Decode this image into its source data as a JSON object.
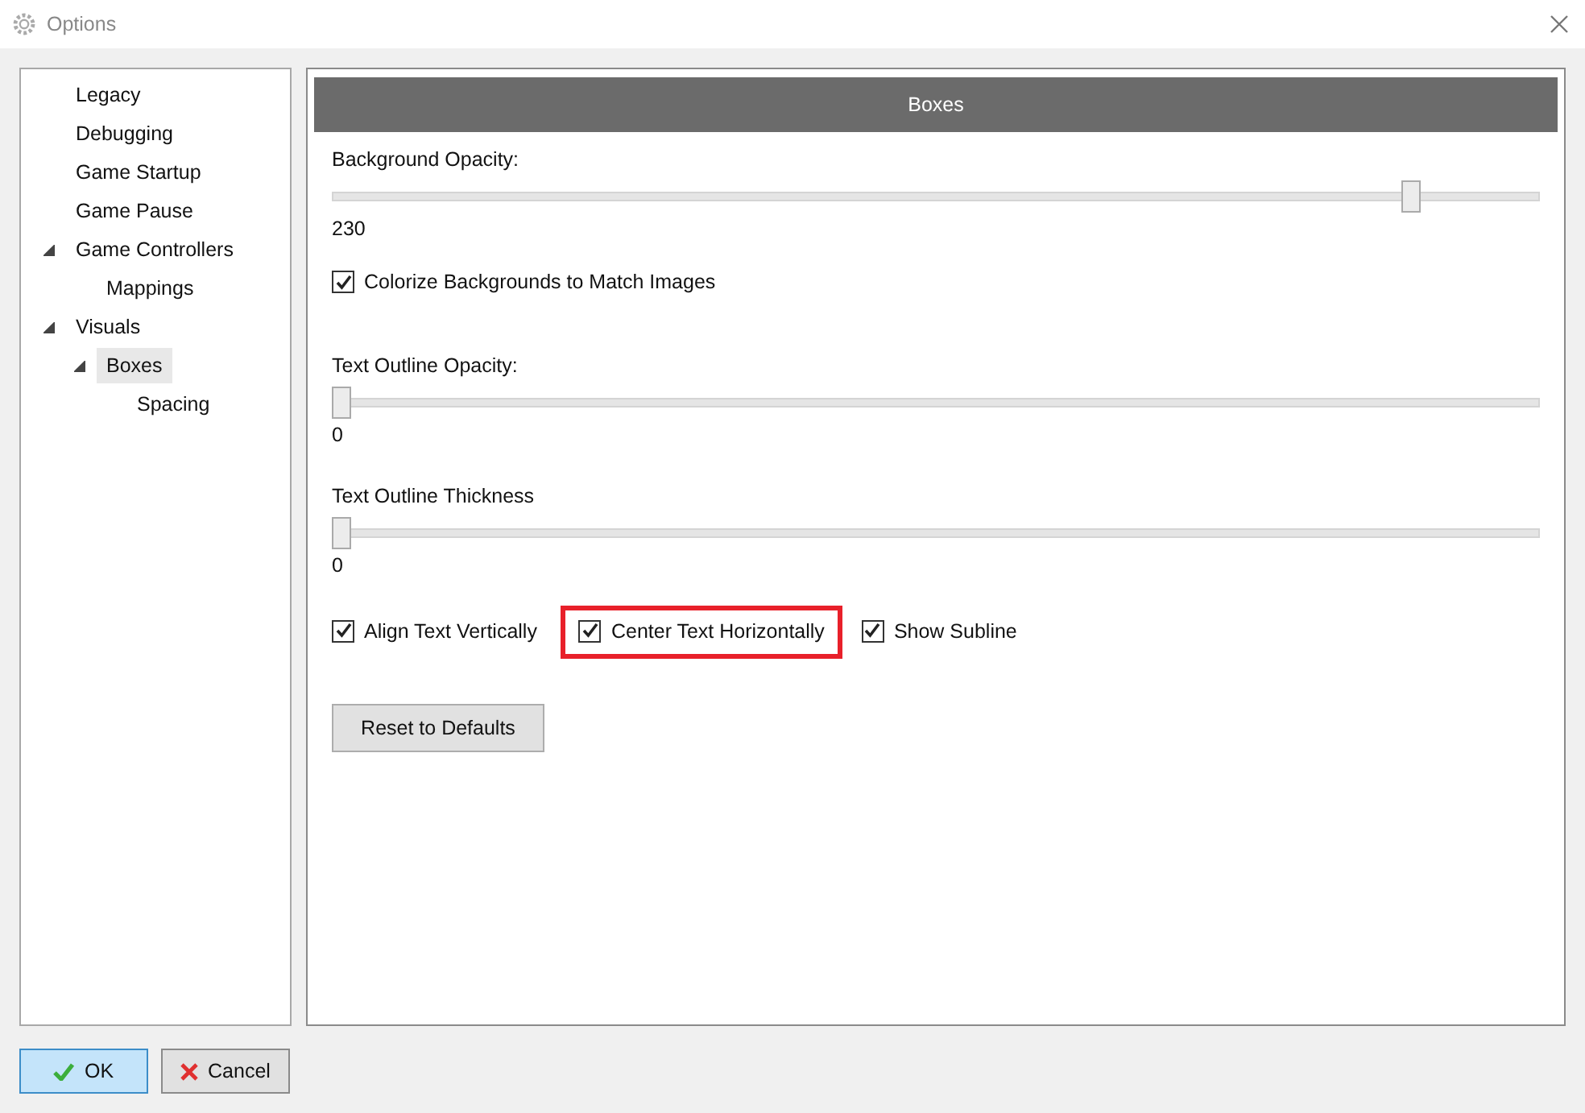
{
  "window": {
    "title": "Options"
  },
  "tree": [
    {
      "label": "Legacy",
      "selected": false
    },
    {
      "label": "Debugging",
      "selected": false
    },
    {
      "label": "Game Startup",
      "selected": false
    },
    {
      "label": "Game Pause",
      "selected": false
    },
    {
      "label": "Game Controllers",
      "selected": false,
      "expanded": true,
      "children": [
        {
          "label": "Mappings",
          "selected": false
        }
      ]
    },
    {
      "label": "Visuals",
      "selected": false,
      "expanded": true,
      "children": [
        {
          "label": "Boxes",
          "selected": true,
          "expanded": true,
          "children": [
            {
              "label": "Spacing",
              "selected": false
            }
          ]
        }
      ]
    }
  ],
  "panel": {
    "title": "Boxes",
    "sections": [
      {
        "kind": "slider",
        "label": "Background Opacity:",
        "level": 0.9,
        "reading": "230"
      },
      {
        "kind": "checkbox",
        "label": "Colorize Backgrounds to Match Images",
        "checked": true
      },
      {
        "kind": "slider",
        "label": "Text Outline Opacity:",
        "level": 0,
        "reading": "0"
      },
      {
        "kind": "slider",
        "label": "Text Outline Thickness",
        "level": 0,
        "reading": "0"
      }
    ],
    "options": [
      {
        "label": "Align Text Vertically",
        "checked": true,
        "highlighted": false
      },
      {
        "label": "Center Text Horizontally",
        "checked": true,
        "highlighted": true
      },
      {
        "label": "Show Subline",
        "checked": true,
        "highlighted": false
      }
    ],
    "reset_button": "Reset to Defaults"
  },
  "buttons": [
    {
      "label": "OK",
      "kind": "ok"
    },
    {
      "label": "Cancel",
      "kind": "cancel"
    }
  ]
}
